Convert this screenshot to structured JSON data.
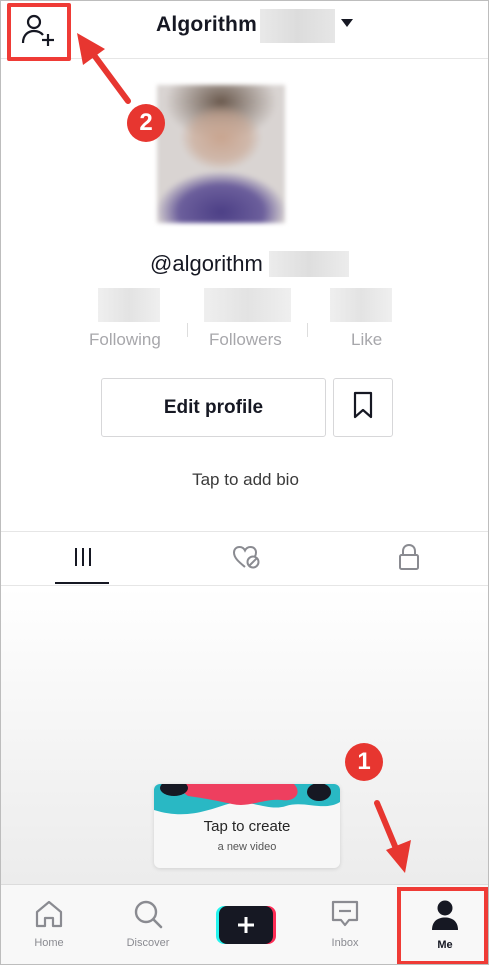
{
  "header": {
    "title": "Algorithm",
    "add_user_icon": "add-user-icon",
    "dropdown_icon": "caret-down-icon"
  },
  "profile": {
    "username": "@algorithm",
    "stats": [
      {
        "label": "Following"
      },
      {
        "label": "Followers"
      },
      {
        "label": "Like"
      }
    ],
    "edit_profile_label": "Edit profile",
    "bookmark_icon": "bookmark-icon",
    "bio_placeholder": "Tap to add bio"
  },
  "tabs": [
    {
      "icon": "grid-icon",
      "active": true
    },
    {
      "icon": "liked-hidden-icon",
      "active": false
    },
    {
      "icon": "lock-icon",
      "active": false
    }
  ],
  "create_card": {
    "title": "Tap to create",
    "subtitle": "a new video"
  },
  "bottom_nav": {
    "items": [
      {
        "label": "Home",
        "icon": "home-icon"
      },
      {
        "label": "Discover",
        "icon": "search-icon"
      },
      {
        "label": "",
        "icon": "plus-icon"
      },
      {
        "label": "Inbox",
        "icon": "inbox-icon"
      },
      {
        "label": "Me",
        "icon": "person-icon"
      }
    ]
  },
  "annotations": {
    "step1": "1",
    "step2": "2",
    "color": "#e73630"
  }
}
